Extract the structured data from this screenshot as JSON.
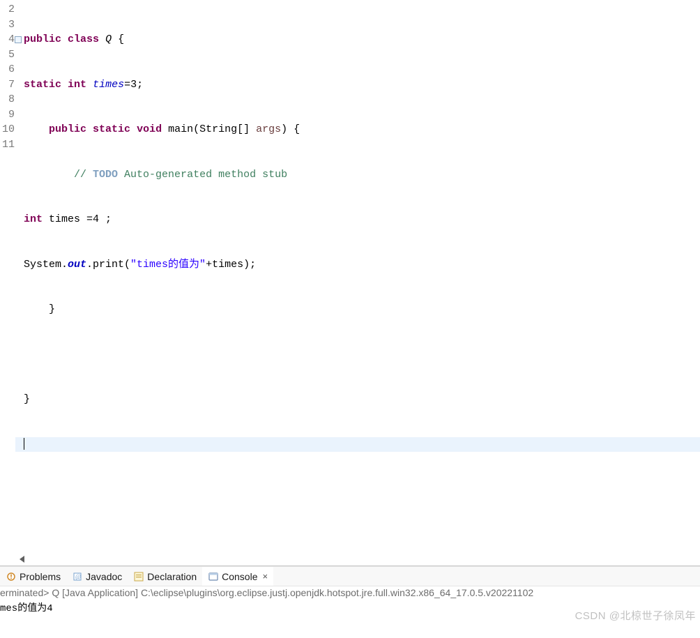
{
  "gutter": {
    "lines": [
      2,
      3,
      4,
      5,
      6,
      7,
      8,
      9,
      10,
      11
    ],
    "fold_line": 4
  },
  "code": {
    "l2": {
      "kw_public": "public",
      "kw_class": "class",
      "cls": "Q",
      "brace": " {"
    },
    "l3": {
      "kw_static": "static",
      "kw_int": "int",
      "field": "times",
      "rest": "=3;"
    },
    "l4": {
      "indent": "    ",
      "kw_public": "public",
      "kw_static": "static",
      "kw_void": "void",
      "m": " main(String[] ",
      "arg": "args",
      "end": ") {"
    },
    "l5": {
      "indent": "        ",
      "cm1": "// ",
      "todo": "TODO",
      "cm2": " Auto-generated method stub"
    },
    "l6": {
      "kw_int": "int",
      "var": " times =4 ;"
    },
    "l7": {
      "a": "System.",
      "out": "out",
      "b": ".print(",
      "str": "\"times的值为\"",
      "c": "+times);"
    },
    "l8": {
      "indent": "    ",
      "brace": "}"
    },
    "l10": {
      "brace": "}"
    }
  },
  "tabs": {
    "problems": "Problems",
    "javadoc": "Javadoc",
    "declaration": "Declaration",
    "console": "Console"
  },
  "terminated_line": "erminated> Q [Java Application] C:\\eclipse\\plugins\\org.eclipse.justj.openjdk.hotspot.jre.full.win32.x86_64_17.0.5.v20221102",
  "console_output": "mes的值为4",
  "watermark": "CSDN @北椋世子徐凤年"
}
